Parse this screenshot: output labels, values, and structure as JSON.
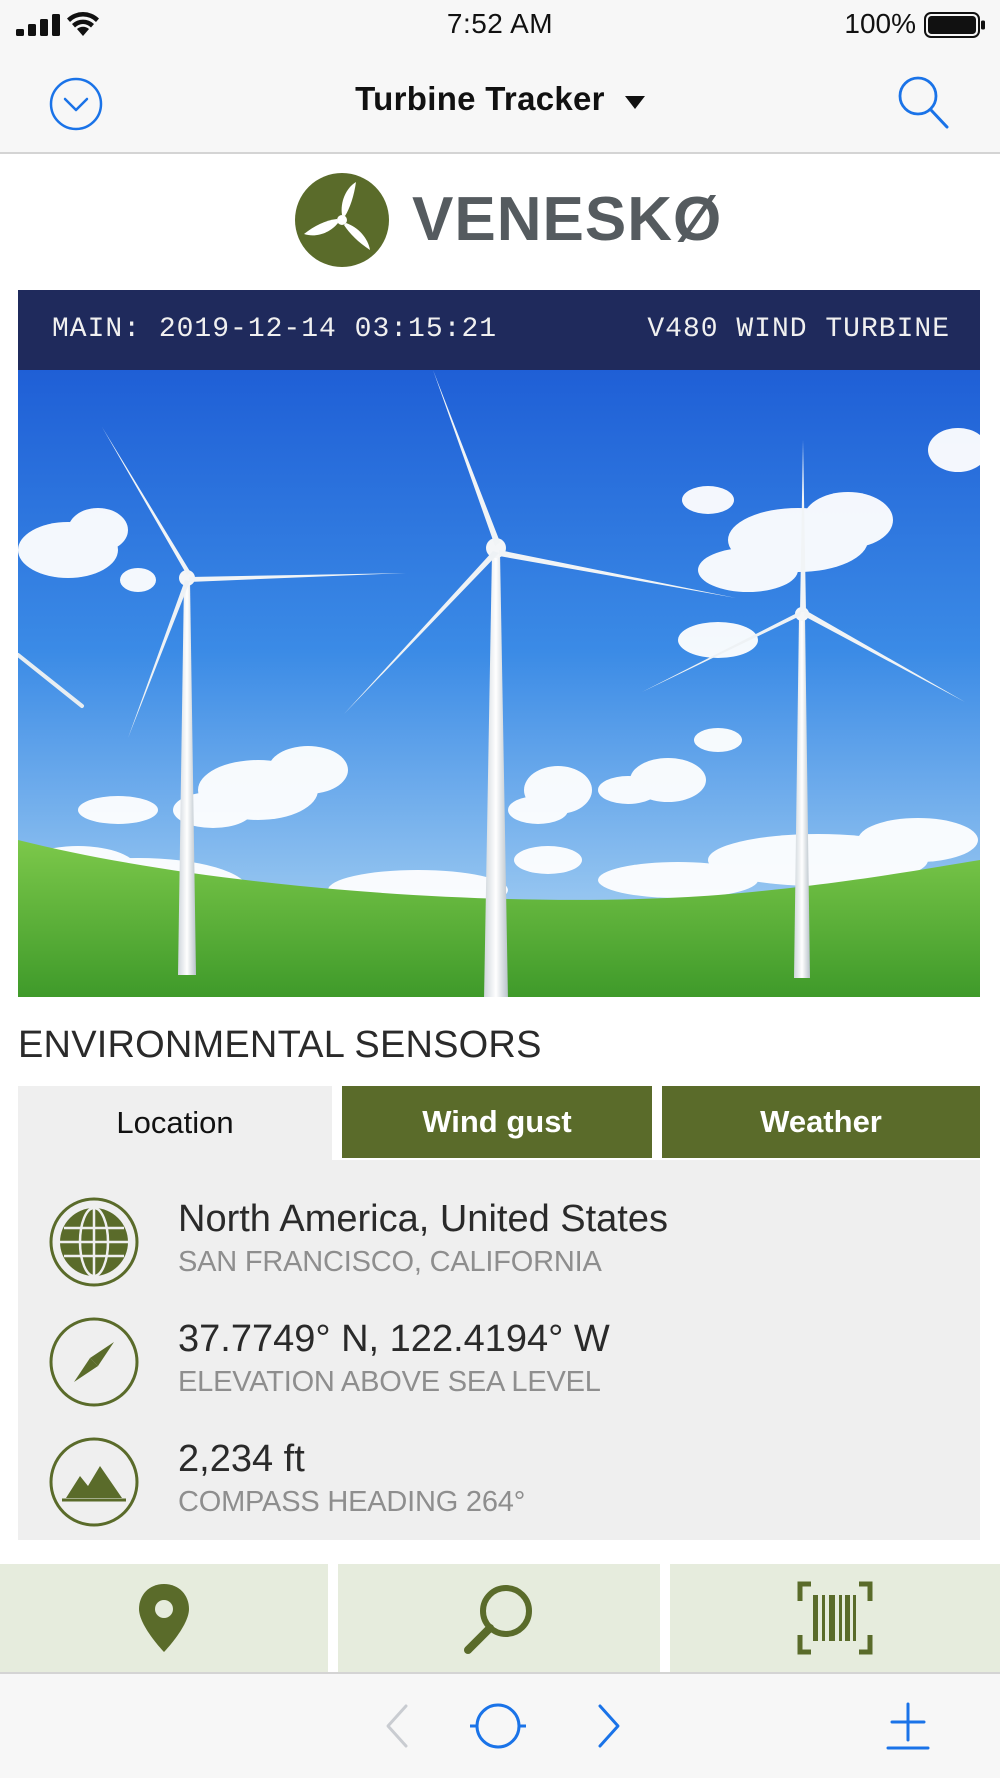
{
  "status_bar": {
    "time": "7:52 AM",
    "battery": "100%"
  },
  "nav": {
    "title": "Turbine Tracker",
    "left_icon": "chevron-circle-down-icon",
    "right_icon": "search-icon"
  },
  "brand": {
    "name": "VENESKØ"
  },
  "banner": {
    "left": "MAIN: 2019-12-14 03:15:21",
    "right": "V480 WIND TURBINE"
  },
  "hero": {
    "description_icon": "wind-turbines-photo"
  },
  "section": {
    "title": "ENVIRONMENTAL SENSORS"
  },
  "tabs": [
    {
      "label": "Location",
      "active": true
    },
    {
      "label": "Wind gust",
      "active": false
    },
    {
      "label": "Weather",
      "active": false
    }
  ],
  "sensors": [
    {
      "icon": "globe-icon",
      "primary": "North America, United States",
      "secondary": "SAN FRANCISCO, CALIFORNIA"
    },
    {
      "icon": "compass-icon",
      "primary": "37.7749° N, 122.4194° W",
      "secondary": "ELEVATION ABOVE SEA LEVEL"
    },
    {
      "icon": "mountain-icon",
      "primary": "2,234 ft",
      "secondary": "COMPASS HEADING 264°"
    }
  ],
  "actions": [
    {
      "icon": "map-pin-icon"
    },
    {
      "icon": "magnifier-icon"
    },
    {
      "icon": "barcode-scan-icon"
    }
  ],
  "toolbar": {
    "back_icon": "chevron-left-icon",
    "home_icon": "circle-icon",
    "forward_icon": "chevron-right-icon",
    "add_icon": "plus-icon"
  },
  "colors": {
    "brand_green": "#5a6b2a",
    "banner_navy": "#1f2a5c",
    "ios_blue": "#1a73e8"
  }
}
